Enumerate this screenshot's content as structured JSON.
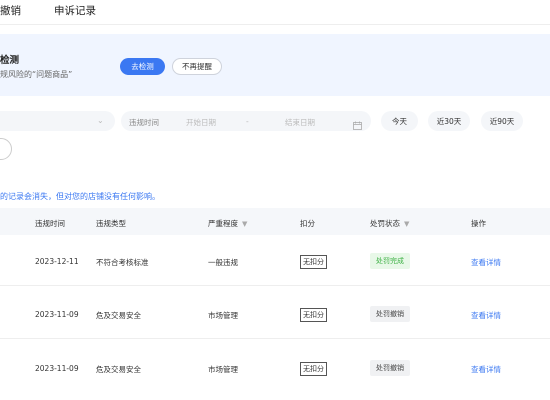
{
  "tabs": [
    {
      "label": "撤销"
    },
    {
      "label": "申诉记录"
    }
  ],
  "banner": {
    "title": "检测",
    "description": "规风险的“问题商品”",
    "primary_button": "去检测",
    "secondary_button": "不再提醒"
  },
  "filters": {
    "date_label": "违规时间",
    "start_placeholder": "开始日期",
    "separator": "-",
    "end_placeholder": "结束日期",
    "quick_ranges": [
      "今天",
      "近30天",
      "近90天"
    ]
  },
  "notice": "的记录会消失，但对您的店铺没有任何影响。",
  "table": {
    "columns": [
      "违规时间",
      "违规类型",
      "严重程度",
      "扣分",
      "处罚状态",
      "操作"
    ],
    "rows": [
      {
        "time": "2023-12-11",
        "type": "不符合考核标准",
        "severity": "一般违规",
        "deduction": "无扣分",
        "status": "处罚完成",
        "action": "查看详情"
      },
      {
        "time": "2023-11-09",
        "type": "危及交易安全",
        "severity": "市场管理",
        "deduction": "无扣分",
        "status": "处罚撤销",
        "action": "查看详情"
      },
      {
        "time": "2023-11-09",
        "type": "危及交易安全",
        "severity": "市场管理",
        "deduction": "无扣分",
        "status": "处罚撤销",
        "action": "查看详情"
      }
    ]
  },
  "colors": {
    "primary": "#3b78f2",
    "banner_bg": "#f0f5ff",
    "success_bg": "#e8f8e8",
    "success_text": "#3cb043",
    "neutral_bg": "#f0f1f3"
  }
}
